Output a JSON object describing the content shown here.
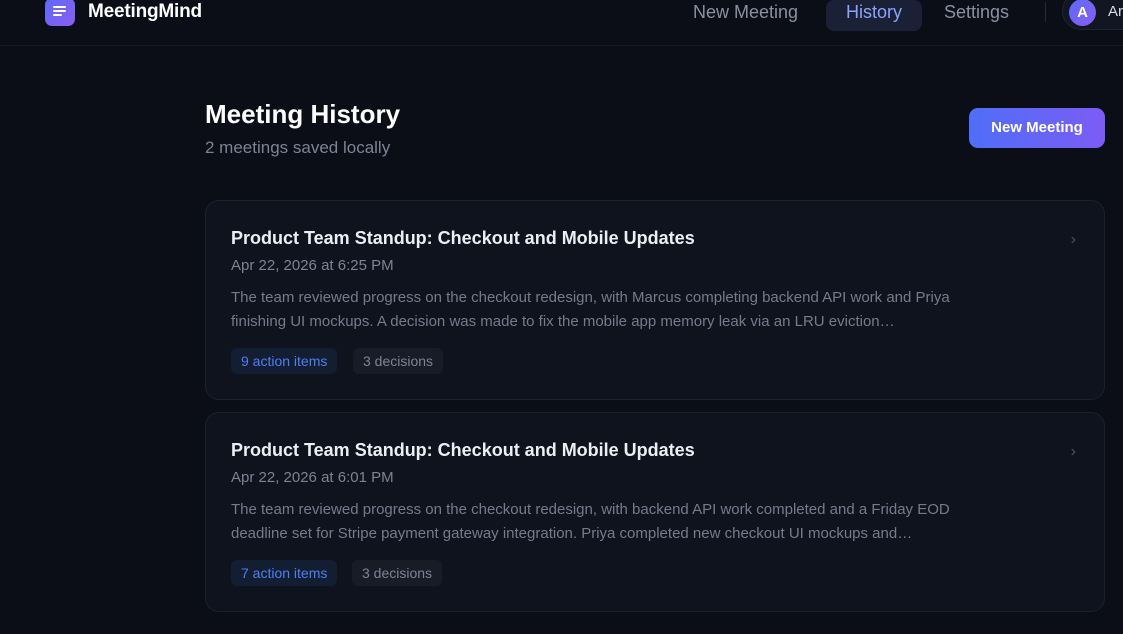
{
  "app": {
    "brand": "MeetingMind"
  },
  "nav": {
    "items": [
      {
        "label": "New Meeting"
      },
      {
        "label": "History"
      },
      {
        "label": "Settings"
      }
    ],
    "user": {
      "avatar_letter": "A",
      "name": "Ar"
    }
  },
  "main": {
    "title": "Meeting History",
    "subtitle": "2 meetings saved locally",
    "new_meeting_button": "New Meeting",
    "meetings": [
      {
        "title": "Product Team Standup: Checkout and Mobile Updates",
        "date": "Apr 22, 2026 at 6:25 PM",
        "summary": "The team reviewed progress on the checkout redesign, with Marcus completing backend API work and Priya finishing UI mockups. A decision was made to fix the mobile app memory leak via an LRU eviction…",
        "action_items": "9 action items",
        "decisions": "3 decisions"
      },
      {
        "title": "Product Team Standup: Checkout and Mobile Updates",
        "date": "Apr 22, 2026 at 6:01 PM",
        "summary": "The team reviewed progress on the checkout redesign, with backend API work completed and a Friday EOD deadline set for Stripe payment gateway integration. Priya completed new checkout UI mockups and…",
        "action_items": "7 action items",
        "decisions": "3 decisions"
      }
    ]
  },
  "colors": {
    "background": "#0b0e17",
    "accent": "#5b6cf7",
    "accent_secondary": "#8b5cf6",
    "action_badge_text": "#4f7ef0"
  },
  "icons": {
    "logo": "document-lines-icon",
    "card_chevron": "chevron-right-icon"
  }
}
